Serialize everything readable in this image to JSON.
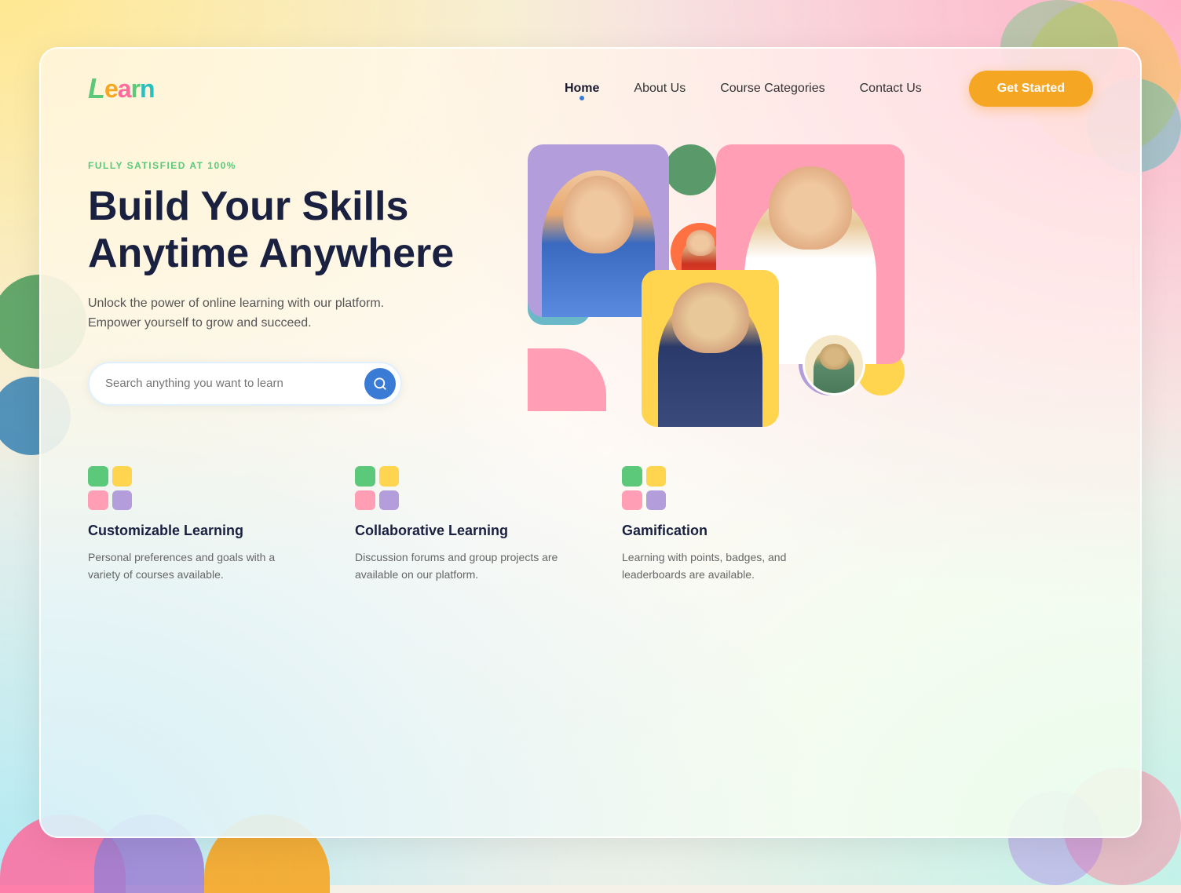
{
  "background": {
    "colors": {
      "topLeft": "#ffe8a0",
      "topRight": "#ffb3c6",
      "bottomLeft": "#b8e8f0",
      "bottomRight": "#c8f0e8"
    }
  },
  "logo": {
    "text": "Learn"
  },
  "navbar": {
    "links": [
      {
        "label": "Home",
        "active": true
      },
      {
        "label": "About Us",
        "active": false
      },
      {
        "label": "Course Categories",
        "active": false
      },
      {
        "label": "Contact Us",
        "active": false
      }
    ],
    "cta": "Get Started"
  },
  "hero": {
    "badge": "Fully Satisfied at 100%",
    "title_line1": "Build Your Skills",
    "title_line2": "Anytime Anywhere",
    "subtitle": "Unlock the power of online learning with our platform. Empower yourself to grow and succeed.",
    "search_placeholder": "Search anything you want to learn"
  },
  "features": [
    {
      "title": "Customizable Learning",
      "description": "Personal preferences and goals with a variety of courses available."
    },
    {
      "title": "Collaborative Learning",
      "description": "Discussion forums and group projects are available on our platform."
    },
    {
      "title": "Gamification",
      "description": "Learning with points, badges, and leaderboards are available."
    }
  ]
}
